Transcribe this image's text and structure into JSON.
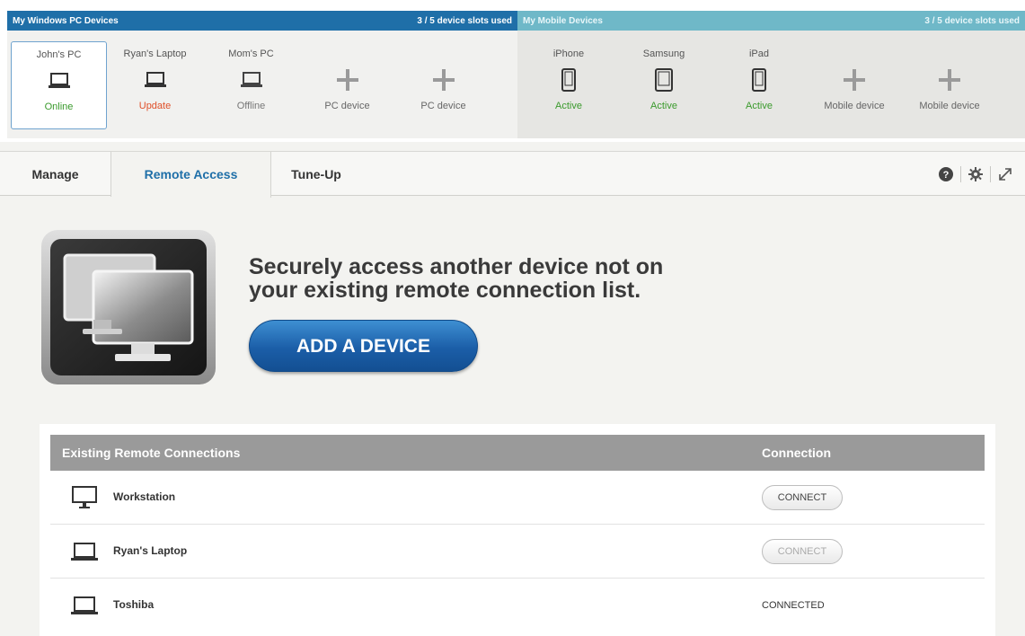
{
  "pc_panel": {
    "title": "My Windows PC Devices",
    "slots": "3 / 5 device slots used",
    "devices": [
      {
        "name": "John's PC",
        "status": "Online"
      },
      {
        "name": "Ryan's Laptop",
        "status": "Update"
      },
      {
        "name": "Mom's PC",
        "status": "Offline"
      }
    ],
    "add_slots": [
      "PC device",
      "PC device"
    ]
  },
  "mobile_panel": {
    "title": "My Mobile Devices",
    "slots": "3 / 5 device slots used",
    "devices": [
      {
        "name": "iPhone",
        "status": "Active"
      },
      {
        "name": "Samsung",
        "status": "Active"
      },
      {
        "name": "iPad",
        "status": "Active"
      }
    ],
    "add_slots": [
      "Mobile device",
      "Mobile device"
    ]
  },
  "tabs": [
    {
      "label": "Manage"
    },
    {
      "label": "Remote Access"
    },
    {
      "label": "Tune-Up"
    }
  ],
  "hero": {
    "headline_line1": "Securely access another device not on",
    "headline_line2": "your existing remote connection list.",
    "add_button": "ADD A DEVICE"
  },
  "connections": {
    "header_name": "Existing Remote Connections",
    "header_connection": "Connection",
    "rows": [
      {
        "name": "Workstation",
        "icon": "desktop-icon",
        "action": "CONNECT"
      },
      {
        "name": "Ryan's Laptop",
        "icon": "laptop-icon",
        "action": "CONNECT"
      },
      {
        "name": "Toshiba",
        "icon": "laptop-icon",
        "action": "CONNECTED"
      }
    ]
  },
  "colors": {
    "accent": "#1f6fa8",
    "mobile_header": "#6fb8c8",
    "status_ok": "#3a9a2c",
    "status_warn": "#e0502a"
  }
}
